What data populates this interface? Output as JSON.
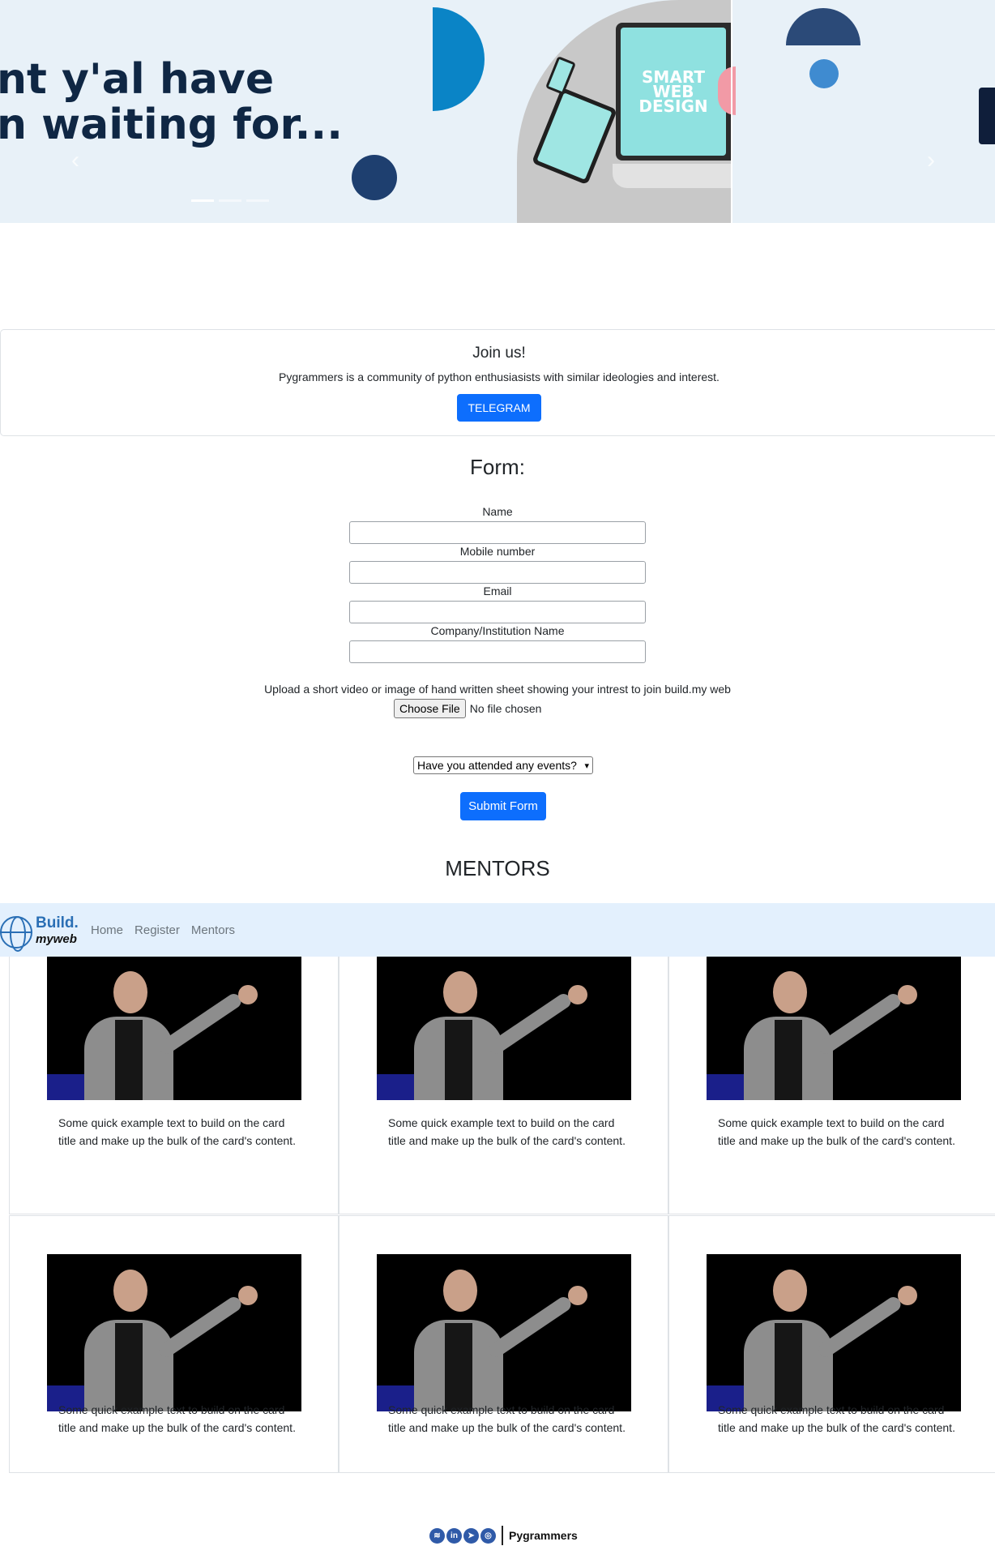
{
  "hero": {
    "headline_line1": "nt y'al have",
    "headline_line2": "n waiting for...",
    "monitor_text_line1": "SMART",
    "monitor_text_line2": "WEB",
    "monitor_text_line3": "DESIGN",
    "prev_glyph": "‹",
    "next_glyph": "›",
    "slide_count": 3,
    "active_slide": 1,
    "colors": {
      "background": "#e8f1f8",
      "headline": "#0f2744",
      "accent_blue": "#0a84c6",
      "navy": "#1e3f6f"
    }
  },
  "join": {
    "title": "Join us!",
    "text": "Pygrammers is a community of python enthusiasists with similar ideologies and interest.",
    "button_label": "TELEGRAM"
  },
  "form": {
    "title": "Form:",
    "fields": [
      {
        "label": "Name",
        "value": ""
      },
      {
        "label": "Mobile number",
        "value": ""
      },
      {
        "label": "Email",
        "value": ""
      },
      {
        "label": "Company/Institution Name",
        "value": ""
      }
    ],
    "upload_text": "Upload a short video or image of hand written sheet showing your intrest to join build.my web",
    "choose_file_label": "Choose File",
    "no_file_text": "No file chosen",
    "events_select_value": "Have you attended any events?",
    "submit_label": "Submit Form"
  },
  "mentors": {
    "title": "MENTORS",
    "cards": [
      {
        "text": "Some quick example text to build on the card title and make up the bulk of the card's content."
      },
      {
        "text": "Some quick example text to build on the card title and make up the bulk of the card's content."
      },
      {
        "text": "Some quick example text to build on the card title and make up the bulk of the card's content."
      },
      {
        "text": "Some quick example text to build on the card title and make up the bulk of the card's content."
      },
      {
        "text": "Some quick example text to build on the card title and make up the bulk of the card's content."
      },
      {
        "text": "Some quick example text to build on the card title and make up the bulk of the card's content."
      }
    ]
  },
  "navbar": {
    "brand_top": "Build.",
    "brand_bottom": "myweb",
    "links": [
      "Home",
      "Register",
      "Mentors"
    ],
    "colors": {
      "background": "#e3f0fd",
      "brand": "#2a6fb5"
    }
  },
  "footer": {
    "icons": [
      "spotify-icon",
      "linkedin-icon",
      "telegram-icon",
      "instagram-icon"
    ],
    "brand": "Pygrammers"
  },
  "theme": {
    "primary": "#0d6efd"
  }
}
